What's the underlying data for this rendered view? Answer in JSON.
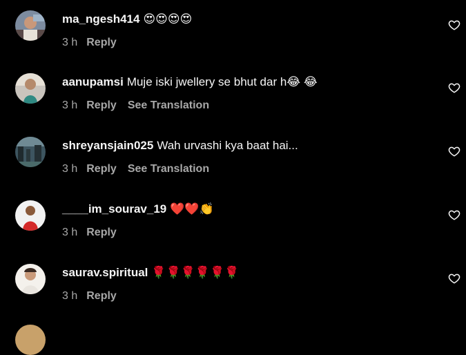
{
  "colors": {
    "background": "#000000",
    "text_primary": "#f5f5f5",
    "text_secondary": "#a8a8a8"
  },
  "comments": [
    {
      "username": "ma_ngesh414",
      "text": "😍😍😍😍",
      "time": "3 h",
      "reply_label": "Reply",
      "translation_label": null,
      "like_icon": "heart-outline-icon"
    },
    {
      "username": "aanupamsi",
      "text": "Muje iski jwellery se bhut dar h😂 😂",
      "time": "3 h",
      "reply_label": "Reply",
      "translation_label": "See Translation",
      "like_icon": "heart-outline-icon"
    },
    {
      "username": "shreyansjain025",
      "text": "Wah urvashi kya baat hai...",
      "time": "3 h",
      "reply_label": "Reply",
      "translation_label": "See Translation",
      "like_icon": "heart-outline-icon"
    },
    {
      "username": "____im_sourav_19",
      "text": "❤️❤️👏",
      "time": "3 h",
      "reply_label": "Reply",
      "translation_label": null,
      "like_icon": "heart-outline-icon"
    },
    {
      "username": "saurav.spiritual",
      "text": "🌹🌹🌹🌹🌹🌹",
      "time": "3 h",
      "reply_label": "Reply",
      "translation_label": null,
      "like_icon": "heart-outline-icon"
    }
  ]
}
